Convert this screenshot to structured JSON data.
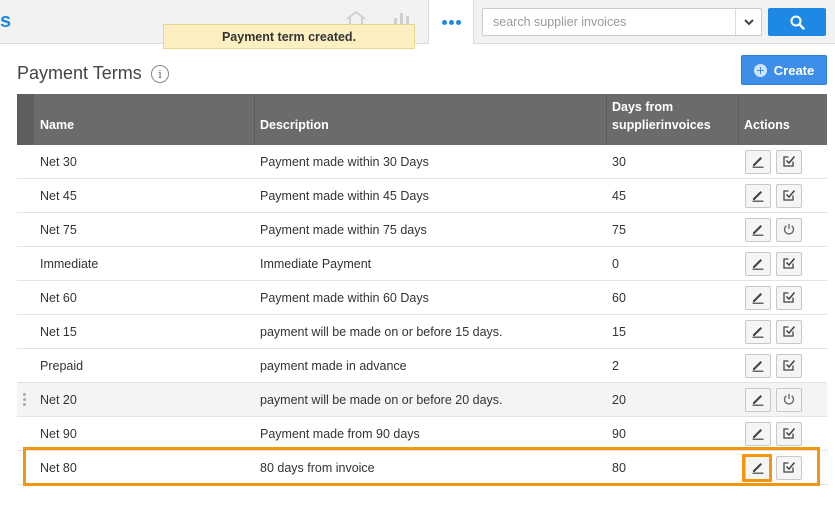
{
  "brand": {
    "letter": "s"
  },
  "search": {
    "placeholder": "search supplier invoices",
    "value": ""
  },
  "toast": {
    "message": "Payment term created."
  },
  "page": {
    "title": "Payment Terms",
    "create_label": "Create"
  },
  "table": {
    "headers": {
      "name": "Name",
      "description": "Description",
      "days_line1": "Days from",
      "days_line2": "supplierinvoices",
      "actions": "Actions"
    },
    "rows": [
      {
        "name": "Net 30",
        "description": "Payment made within 30 Days",
        "days": "30",
        "second_action": "archive"
      },
      {
        "name": "Net 45",
        "description": "Payment made within 45 Days",
        "days": "45",
        "second_action": "archive"
      },
      {
        "name": "Net 75",
        "description": "Payment made within 75 days",
        "days": "75",
        "second_action": "power"
      },
      {
        "name": "Immediate",
        "description": "Immediate Payment",
        "days": "0",
        "second_action": "archive"
      },
      {
        "name": "Net 60",
        "description": "Payment made within 60 Days",
        "days": "60",
        "second_action": "archive"
      },
      {
        "name": "Net 15",
        "description": "payment will be made on or before 15 days.",
        "days": "15",
        "second_action": "archive"
      },
      {
        "name": "Prepaid",
        "description": "payment made in advance",
        "days": "2",
        "second_action": "archive"
      },
      {
        "name": "Net 20",
        "description": "payment will be made on or before 20 days.",
        "days": "20",
        "second_action": "power"
      },
      {
        "name": "Net 90",
        "description": "Payment made from 90 days",
        "days": "90",
        "second_action": "archive"
      },
      {
        "name": "Net 80",
        "description": "80 days from invoice",
        "days": "80",
        "second_action": "archive"
      }
    ]
  },
  "colors": {
    "accent": "#1e88e5",
    "header_bg": "#6b6b6b",
    "highlight": "#f0960f",
    "toast_bg": "#fcf0c3"
  }
}
